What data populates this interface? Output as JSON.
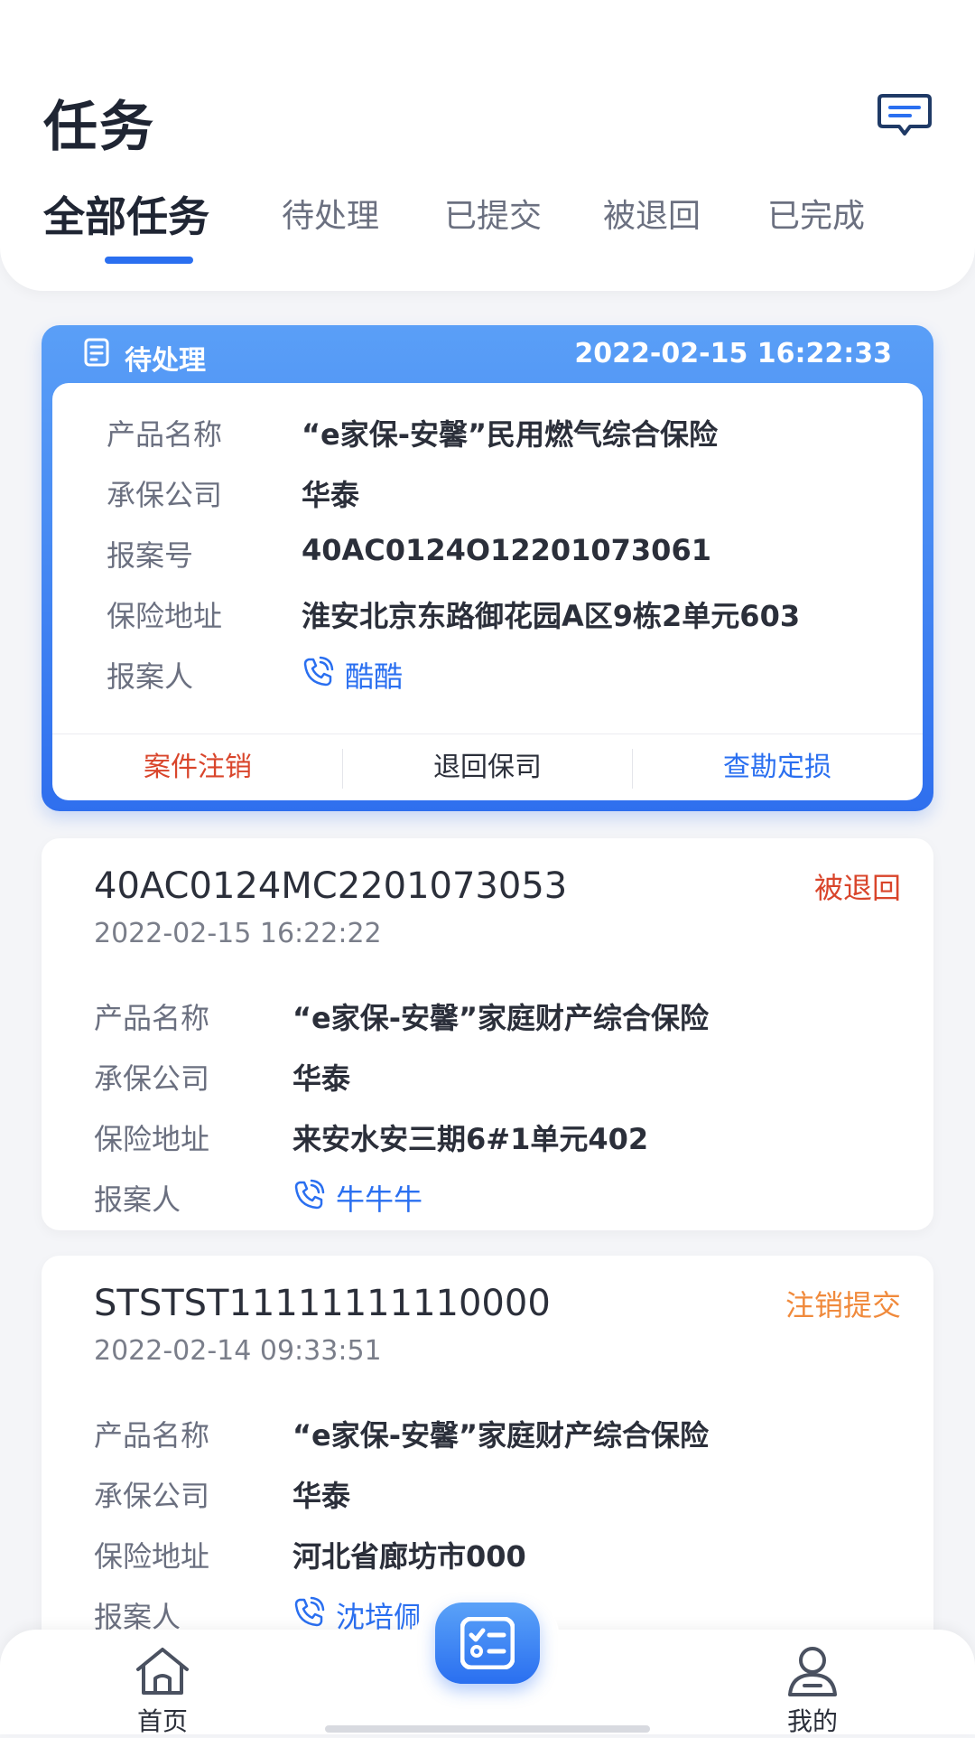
{
  "header": {
    "title": "任务",
    "message_icon": "chat-message-icon"
  },
  "tabs": [
    {
      "label": "全部任务",
      "active": true
    },
    {
      "label": "待处理",
      "active": false
    },
    {
      "label": "已提交",
      "active": false
    },
    {
      "label": "被退回",
      "active": false
    },
    {
      "label": "已完成",
      "active": false
    }
  ],
  "highlight_task": {
    "status": "待处理",
    "time": "2022-02-15 16:22:33",
    "fields": [
      {
        "label": "产品名称",
        "value": "“e家保-安馨”民用燃气综合保险"
      },
      {
        "label": "承保公司",
        "value": "华泰"
      },
      {
        "label": "报案号",
        "value": "40AC0124O12201073061"
      },
      {
        "label": "保险地址",
        "value": "淮安北京东路御花园A区9栋2单元603"
      },
      {
        "label": "报案人",
        "value": "酷酷"
      }
    ],
    "actions": {
      "cancel": "案件注销",
      "return": "退回保司",
      "survey": "查勘定损"
    }
  },
  "tasks": [
    {
      "case_no": "40AC0124MC2201073053",
      "time": "2022-02-15 16:22:22",
      "status": "被退回",
      "status_color": "#d9452b",
      "fields": [
        {
          "label": "产品名称",
          "value": "“e家保-安馨”家庭财产综合保险"
        },
        {
          "label": "承保公司",
          "value": "华泰"
        },
        {
          "label": "保险地址",
          "value": "来安水安三期6#1单元402"
        },
        {
          "label": "报案人",
          "value": "牛牛牛"
        }
      ]
    },
    {
      "case_no": "STSTST11111111110000",
      "time": "2022-02-14 09:33:51",
      "status": "注销提交",
      "status_color": "#f08a3c",
      "fields": [
        {
          "label": "产品名称",
          "value": "“e家保-安馨”家庭财产综合保险"
        },
        {
          "label": "承保公司",
          "value": "华泰"
        },
        {
          "label": "保险地址",
          "value": "河北省廊坊市000"
        },
        {
          "label": "报案人",
          "value": "沈培佩"
        }
      ]
    }
  ],
  "bottom_nav": {
    "home": "首页",
    "mine": "我的",
    "center_icon": "task-list-icon"
  },
  "colors": {
    "accent": "#2a6ff0",
    "danger": "#d9452b",
    "warning": "#f08a3c"
  }
}
